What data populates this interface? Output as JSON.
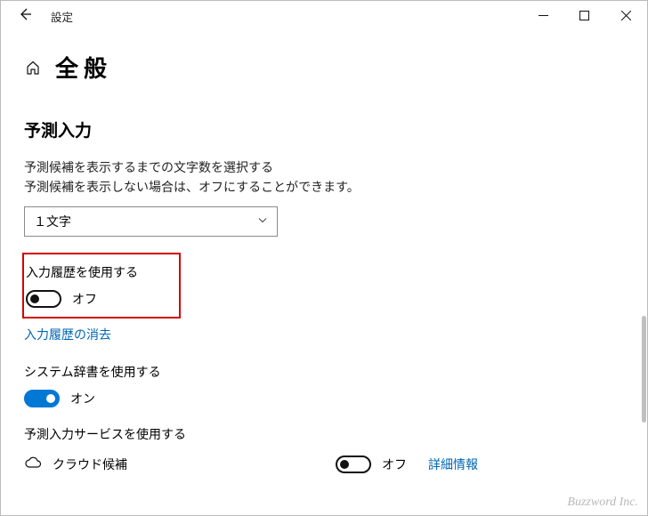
{
  "titlebar": {
    "title": "設定"
  },
  "page": {
    "heading": "全般",
    "section_title": "予測入力",
    "desc_line1": "予測候補を表示するまでの文字数を選択する",
    "desc_line2": "予測候補を表示しない場合は、オフにすることができます。",
    "select_value": "１文字"
  },
  "history": {
    "title": "入力履歴を使用する",
    "toggle_label": "オフ",
    "clear_link": "入力履歴の消去"
  },
  "system_dict": {
    "title": "システム辞書を使用する",
    "toggle_label": "オン"
  },
  "predict_service": {
    "title": "予測入力サービスを使用する",
    "cloud_label": "クラウド候補",
    "toggle_label": "オフ",
    "detail_link": "詳細情報"
  },
  "watermark": "Buzzword Inc."
}
